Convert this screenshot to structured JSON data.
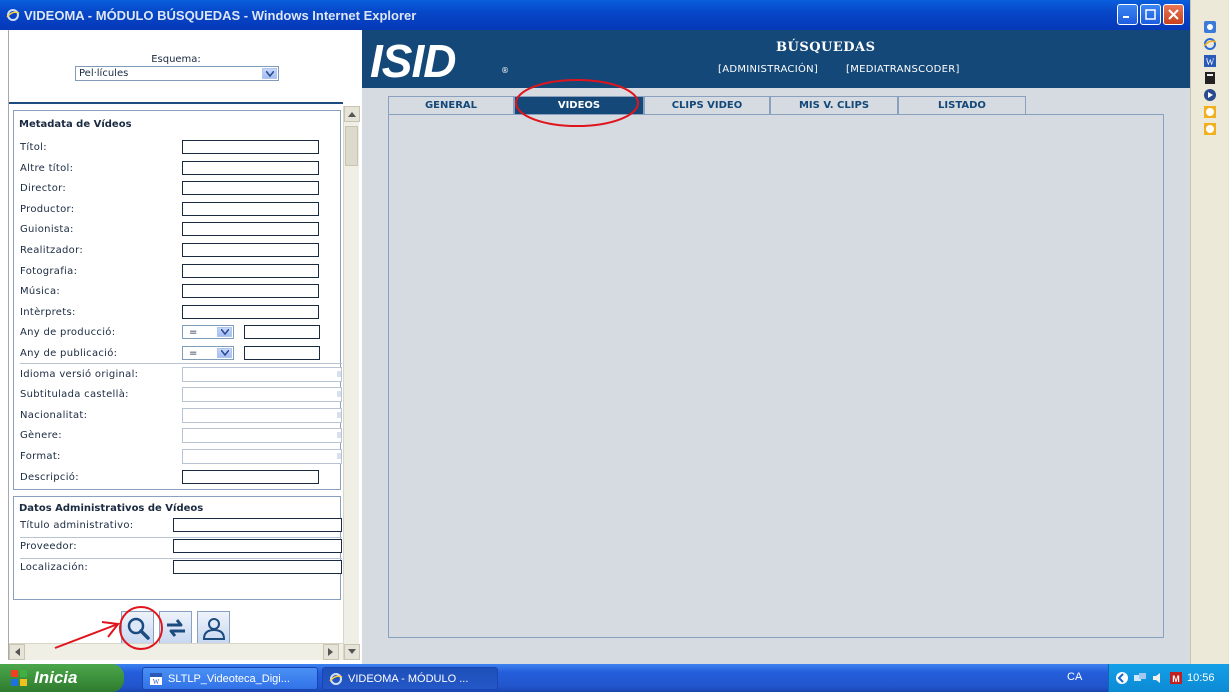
{
  "window": {
    "title": "VIDEOMA - MÓDULO BÚSQUEDAS - Windows Internet Explorer"
  },
  "left": {
    "schema_label": "Esquema:",
    "schema_value": "Pel·lícules",
    "metadata_title": "Metadata de Vídeos",
    "metadata_fields": [
      {
        "label": "Títol:",
        "type": "text"
      },
      {
        "label": "Altre títol:",
        "type": "text"
      },
      {
        "label": "Director:",
        "type": "text"
      },
      {
        "label": "Productor:",
        "type": "text"
      },
      {
        "label": "Guionista:",
        "type": "text"
      },
      {
        "label": "Realitzador:",
        "type": "text"
      },
      {
        "label": "Fotografia:",
        "type": "text"
      },
      {
        "label": "Música:",
        "type": "text"
      },
      {
        "label": "Intèrprets:",
        "type": "text"
      },
      {
        "label": "Any de producció:",
        "type": "compare",
        "operator": "="
      },
      {
        "label": "Any de publicació:",
        "type": "compare",
        "operator": "="
      },
      {
        "label": "Idioma versió original:",
        "type": "combo"
      },
      {
        "label": "Subtitulada castellà:",
        "type": "combo"
      },
      {
        "label": "Nacionalitat:",
        "type": "combo"
      },
      {
        "label": "Gènere:",
        "type": "combo"
      },
      {
        "label": "Format:",
        "type": "combo"
      },
      {
        "label": "Descripció:",
        "type": "text"
      }
    ],
    "admin_title": "Datos Administrativos de Vídeos",
    "admin_fields": [
      {
        "label": "Título administrativo:"
      },
      {
        "label": "Proveedor:"
      },
      {
        "label": "Localización:"
      }
    ],
    "tool_buttons": [
      {
        "name": "search-button",
        "icon": "magnifier-icon"
      },
      {
        "name": "refresh-button",
        "icon": "swap-arrows-icon"
      },
      {
        "name": "user-button",
        "icon": "user-icon"
      }
    ]
  },
  "right": {
    "logo": "ISID",
    "logo_mark": "®",
    "header_title": "BÚSQUEDAS",
    "header_links": [
      "[ADMINISTRACIÓN]",
      "[MEDIATRANSCODER]"
    ],
    "tabs": [
      {
        "label": "GENERAL",
        "active": false
      },
      {
        "label": "VIDEOS",
        "active": true
      },
      {
        "label": "CLIPS VIDEO",
        "active": false
      },
      {
        "label": "MIS V. CLIPS",
        "active": false
      },
      {
        "label": "LISTADO",
        "active": false
      }
    ]
  },
  "taskbar": {
    "start_label": "Inicia",
    "tasks": [
      {
        "label": "SLTLP_Videoteca_Digi...",
        "active": false
      },
      {
        "label": "VIDEOMA - MÓDULO ...",
        "active": true
      }
    ],
    "language": "CA",
    "clock": "10:56"
  },
  "colors": {
    "header_bg": "#134878",
    "panel_bg": "#d6dbe2",
    "annotation_red": "#e0141c",
    "titlebar_blue": "#0647c8"
  }
}
